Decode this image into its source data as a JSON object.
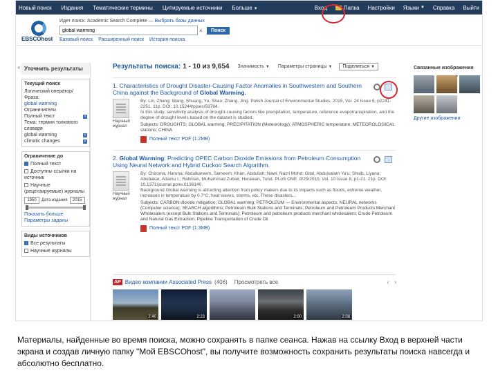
{
  "topnav": {
    "items": [
      "Новый поиск",
      "Издания",
      "Тематические термины",
      "Цитируемые источники",
      "Больше"
    ],
    "login": "Вход",
    "folder": "Папка",
    "settings": "Настройки",
    "languages": "Языки",
    "help": "Справка",
    "exit": "Выйти"
  },
  "header": {
    "logo_text": "EBSCOhost",
    "search_label_prefix": "Идет поиск: Academic Search Complete",
    "search_label_link": "Выбрать базы данных",
    "search_value": "global warming",
    "search_button": "Поиск",
    "links": [
      "Базовый поиск",
      "Расширенный поиск",
      "История поиска"
    ]
  },
  "sidebar": {
    "collapse": "«",
    "title": "Уточнить результаты",
    "current_search_heading": "Текущий поиск",
    "boolean_label": "Логический оператор/Фраза:",
    "boolean_value": "global warming",
    "expanders_label": "Ограничители",
    "fulltext_label": "Полный текст",
    "subject_label": "Тема: термин толкового словаря",
    "subject_value1": "global warming",
    "subject_value2": "climatic changes",
    "limit_heading": "Ограничение до",
    "limit_fulltext": "Полный текст",
    "limit_refs": "Доступны ссылки на источник",
    "limit_peer": "Научные (рецензируемые) журналы",
    "date_from": "1950",
    "date_label": "Дата издания",
    "date_to": "2015",
    "show_more": "Показать больше",
    "options": "Параметры заданы",
    "source_types_heading": "Виды источников",
    "source_all": "Все результаты",
    "source_academic": "Научные журналы"
  },
  "results": {
    "title": "Результаты поиска:",
    "count": "1 - 10 из 9,654",
    "relevance": "Значимость",
    "page_options": "Параметры страницы",
    "share": "Поделиться",
    "items": [
      {
        "number": "1.",
        "title_a": "Characteristics of Drought Disaster-Causing Factor Anomalies in Southwestern and Southern China against the Background of ",
        "title_b": "Global Warming.",
        "thumb_label": "Научный журнал",
        "authors": "By: Lin, Zhang; Wang, Shuang; Yu, Shao; Zhang, Jing. Polish Journal of Environmental Studies. 2015, Vol. 24 Issue 6, p2241-2251. 11p. DOI: 10.15244/pjoes/59784.",
        "abstract": "In this study, sensitivity analysis of drought-causing factors like precipitation, temperature, reference evapotranspiration, and the degree of drought levels based on the dataset is studied.",
        "subjects": "Subjects: DROUGHTS; GLOBAL warming; PRECIPITATION (Meteorology); ATMOSPHERIC temperature; METEOROLOGICAL stations; CHINA",
        "pdf": "Полный текст PDF (1.2MB)"
      },
      {
        "number": "2.",
        "title_a": "",
        "title_b": "Global Warming",
        "title_c": ": Predicting OPEC Carbon Dioxide Emissions from Petroleum Consumption Using Neural Network and Hybrid Cuckoo Search Algorithm.",
        "thumb_label": "Научный журнал",
        "authors": "By: Chiroma, Haruna; Abdulkareem, Sameem; Khan, Abdullah; Nawi, Nazri Mohd; Gital, Abdulsalam Ya'u; Shuib, Liyana; Abubakar, Adamu I.; Rahman, Muhammad Zubair; Herawan, Tutut. PLoS ONE. 8/25/2015, Vol. 10 Issue 8, p1-21. 21p. DOI: 10.1371/journal.pone.0136140.",
        "abstract": "Background Global warming is attracting attention from policy makers due to its impacts such as floods, extreme weather, increases in temperature by 0.7°C, heat waves, storms, etc. These disasters...",
        "subjects": "Subjects: CARBON dioxide mitigation; GLOBAL warming; PETROLEUM — Environmental aspects; NEURAL networks (Computer science); SEARCH algorithms; Petroleum Bulk Stations and Terminals; Petroleum and Petroleum Products Merchant Wholesalers (except Bulk Stations and Terminals); Petroleum and petroleum products merchant wholesalers; Crude Petroleum and Natural Gas Extraction; Pipeline Transportation of Crude Oil",
        "pdf": "Полный текст PDF (1.3MB)"
      }
    ]
  },
  "video": {
    "ap_logo": "AP",
    "title": "Видео компании Associated Press",
    "count": "(406)",
    "show": "Просмотреть все",
    "arrows": [
      "‹",
      "›"
    ],
    "durations": [
      "2:40",
      "2:23",
      "",
      "2:00",
      "2:08"
    ]
  },
  "right": {
    "title": "Связанные изображения",
    "collapse": "»",
    "more": "Другие изображения"
  },
  "caption": "Материалы, найденные во время поиска, можно сохранять в папке сеанса. Нажав на ссылку Вход в верхней части экрана и создав личную папку \"Мой EBSCOhost\", вы получите возможность сохранить результаты поиска навсегда и абсолютно бесплатно."
}
